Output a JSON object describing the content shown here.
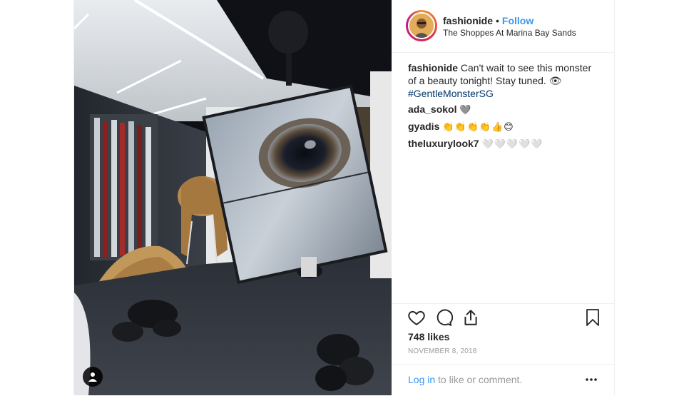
{
  "header": {
    "username": "fashionide",
    "separator": "•",
    "follow_label": "Follow",
    "location": "The Shoppes At Marina Bay Sands"
  },
  "comments": [
    {
      "user": "fashionide",
      "text": "Can't wait to see this monster of a beauty tonight! Stay tuned. 👁",
      "hashtag": "#GentleMonsterSG"
    },
    {
      "user": "ada_sokol",
      "text": "🩶"
    },
    {
      "user": "gyadis",
      "text": "👏👏👏👏👍😊"
    },
    {
      "user": "theluxurylook7",
      "text": "🤍🤍🤍🤍🤍"
    }
  ],
  "actions": {
    "like_icon": "heart-outline-icon",
    "comment_icon": "speech-bubble-icon",
    "share_icon": "share-icon",
    "save_icon": "bookmark-icon"
  },
  "likes_text": "748 likes",
  "date_text": "NOVEMBER 8, 2018",
  "login": {
    "link_label": "Log in",
    "rest_text": " to like or comment."
  },
  "colors": {
    "accent": "#3897f0",
    "hashtag": "#003569",
    "muted": "#999999",
    "border": "#efefef"
  }
}
